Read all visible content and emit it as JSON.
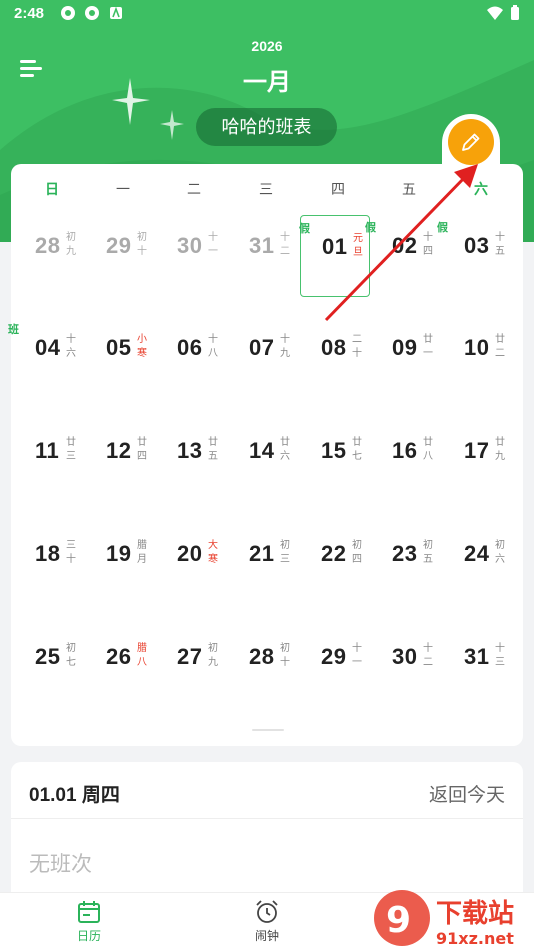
{
  "status_bar": {
    "time": "2:48"
  },
  "header": {
    "year": "2026",
    "month": "一月",
    "roster_name": "哈哈的班表"
  },
  "weekdays": [
    "日",
    "一",
    "二",
    "三",
    "四",
    "五",
    "六"
  ],
  "calendar": {
    "rows": [
      [
        {
          "d": "28",
          "l1": "初",
          "l2": "九",
          "other": true
        },
        {
          "d": "29",
          "l1": "初",
          "l2": "十",
          "other": true
        },
        {
          "d": "30",
          "l1": "十",
          "l2": "一",
          "other": true
        },
        {
          "d": "31",
          "l1": "十",
          "l2": "二",
          "other": true
        },
        {
          "d": "01",
          "l1": "元",
          "l2": "旦",
          "red": true,
          "today": true,
          "tag": "假"
        },
        {
          "d": "02",
          "l1": "十",
          "l2": "四",
          "tag": "假"
        },
        {
          "d": "03",
          "l1": "十",
          "l2": "五",
          "tag": "假"
        }
      ],
      [
        {
          "d": "04",
          "l1": "十",
          "l2": "六",
          "tag": "班"
        },
        {
          "d": "05",
          "l1": "小",
          "l2": "寒",
          "red": true
        },
        {
          "d": "06",
          "l1": "十",
          "l2": "八"
        },
        {
          "d": "07",
          "l1": "十",
          "l2": "九"
        },
        {
          "d": "08",
          "l1": "二",
          "l2": "十"
        },
        {
          "d": "09",
          "l1": "廿",
          "l2": "一"
        },
        {
          "d": "10",
          "l1": "廿",
          "l2": "二"
        }
      ],
      [
        {
          "d": "11",
          "l1": "廿",
          "l2": "三"
        },
        {
          "d": "12",
          "l1": "廿",
          "l2": "四"
        },
        {
          "d": "13",
          "l1": "廿",
          "l2": "五"
        },
        {
          "d": "14",
          "l1": "廿",
          "l2": "六"
        },
        {
          "d": "15",
          "l1": "廿",
          "l2": "七"
        },
        {
          "d": "16",
          "l1": "廿",
          "l2": "八"
        },
        {
          "d": "17",
          "l1": "廿",
          "l2": "九"
        }
      ],
      [
        {
          "d": "18",
          "l1": "三",
          "l2": "十"
        },
        {
          "d": "19",
          "l1": "腊",
          "l2": "月"
        },
        {
          "d": "20",
          "l1": "大",
          "l2": "寒",
          "red": true
        },
        {
          "d": "21",
          "l1": "初",
          "l2": "三"
        },
        {
          "d": "22",
          "l1": "初",
          "l2": "四"
        },
        {
          "d": "23",
          "l1": "初",
          "l2": "五"
        },
        {
          "d": "24",
          "l1": "初",
          "l2": "六"
        }
      ],
      [
        {
          "d": "25",
          "l1": "初",
          "l2": "七"
        },
        {
          "d": "26",
          "l1": "腊",
          "l2": "八",
          "red": true
        },
        {
          "d": "27",
          "l1": "初",
          "l2": "九"
        },
        {
          "d": "28",
          "l1": "初",
          "l2": "十"
        },
        {
          "d": "29",
          "l1": "十",
          "l2": "一"
        },
        {
          "d": "30",
          "l1": "十",
          "l2": "二"
        },
        {
          "d": "31",
          "l1": "十",
          "l2": "三"
        }
      ]
    ]
  },
  "selected_info": {
    "date": "01.01 周四",
    "back_today": "返回今天",
    "no_shift": "无班次"
  },
  "bottom_nav": {
    "calendar_label": "日历",
    "alarm_label": "闹钟"
  },
  "watermark": {
    "brand": "下载站",
    "domain": "91xz.net"
  },
  "colors": {
    "primary_green": "#3dbf63",
    "edit_orange": "#f7a20a",
    "holiday_red": "#e8402e",
    "annotation_red": "#e02020"
  },
  "icons": [
    "menu-icon",
    "pencil-icon",
    "calendar-icon",
    "alarm-clock-icon",
    "wifi-icon",
    "battery-icon"
  ]
}
